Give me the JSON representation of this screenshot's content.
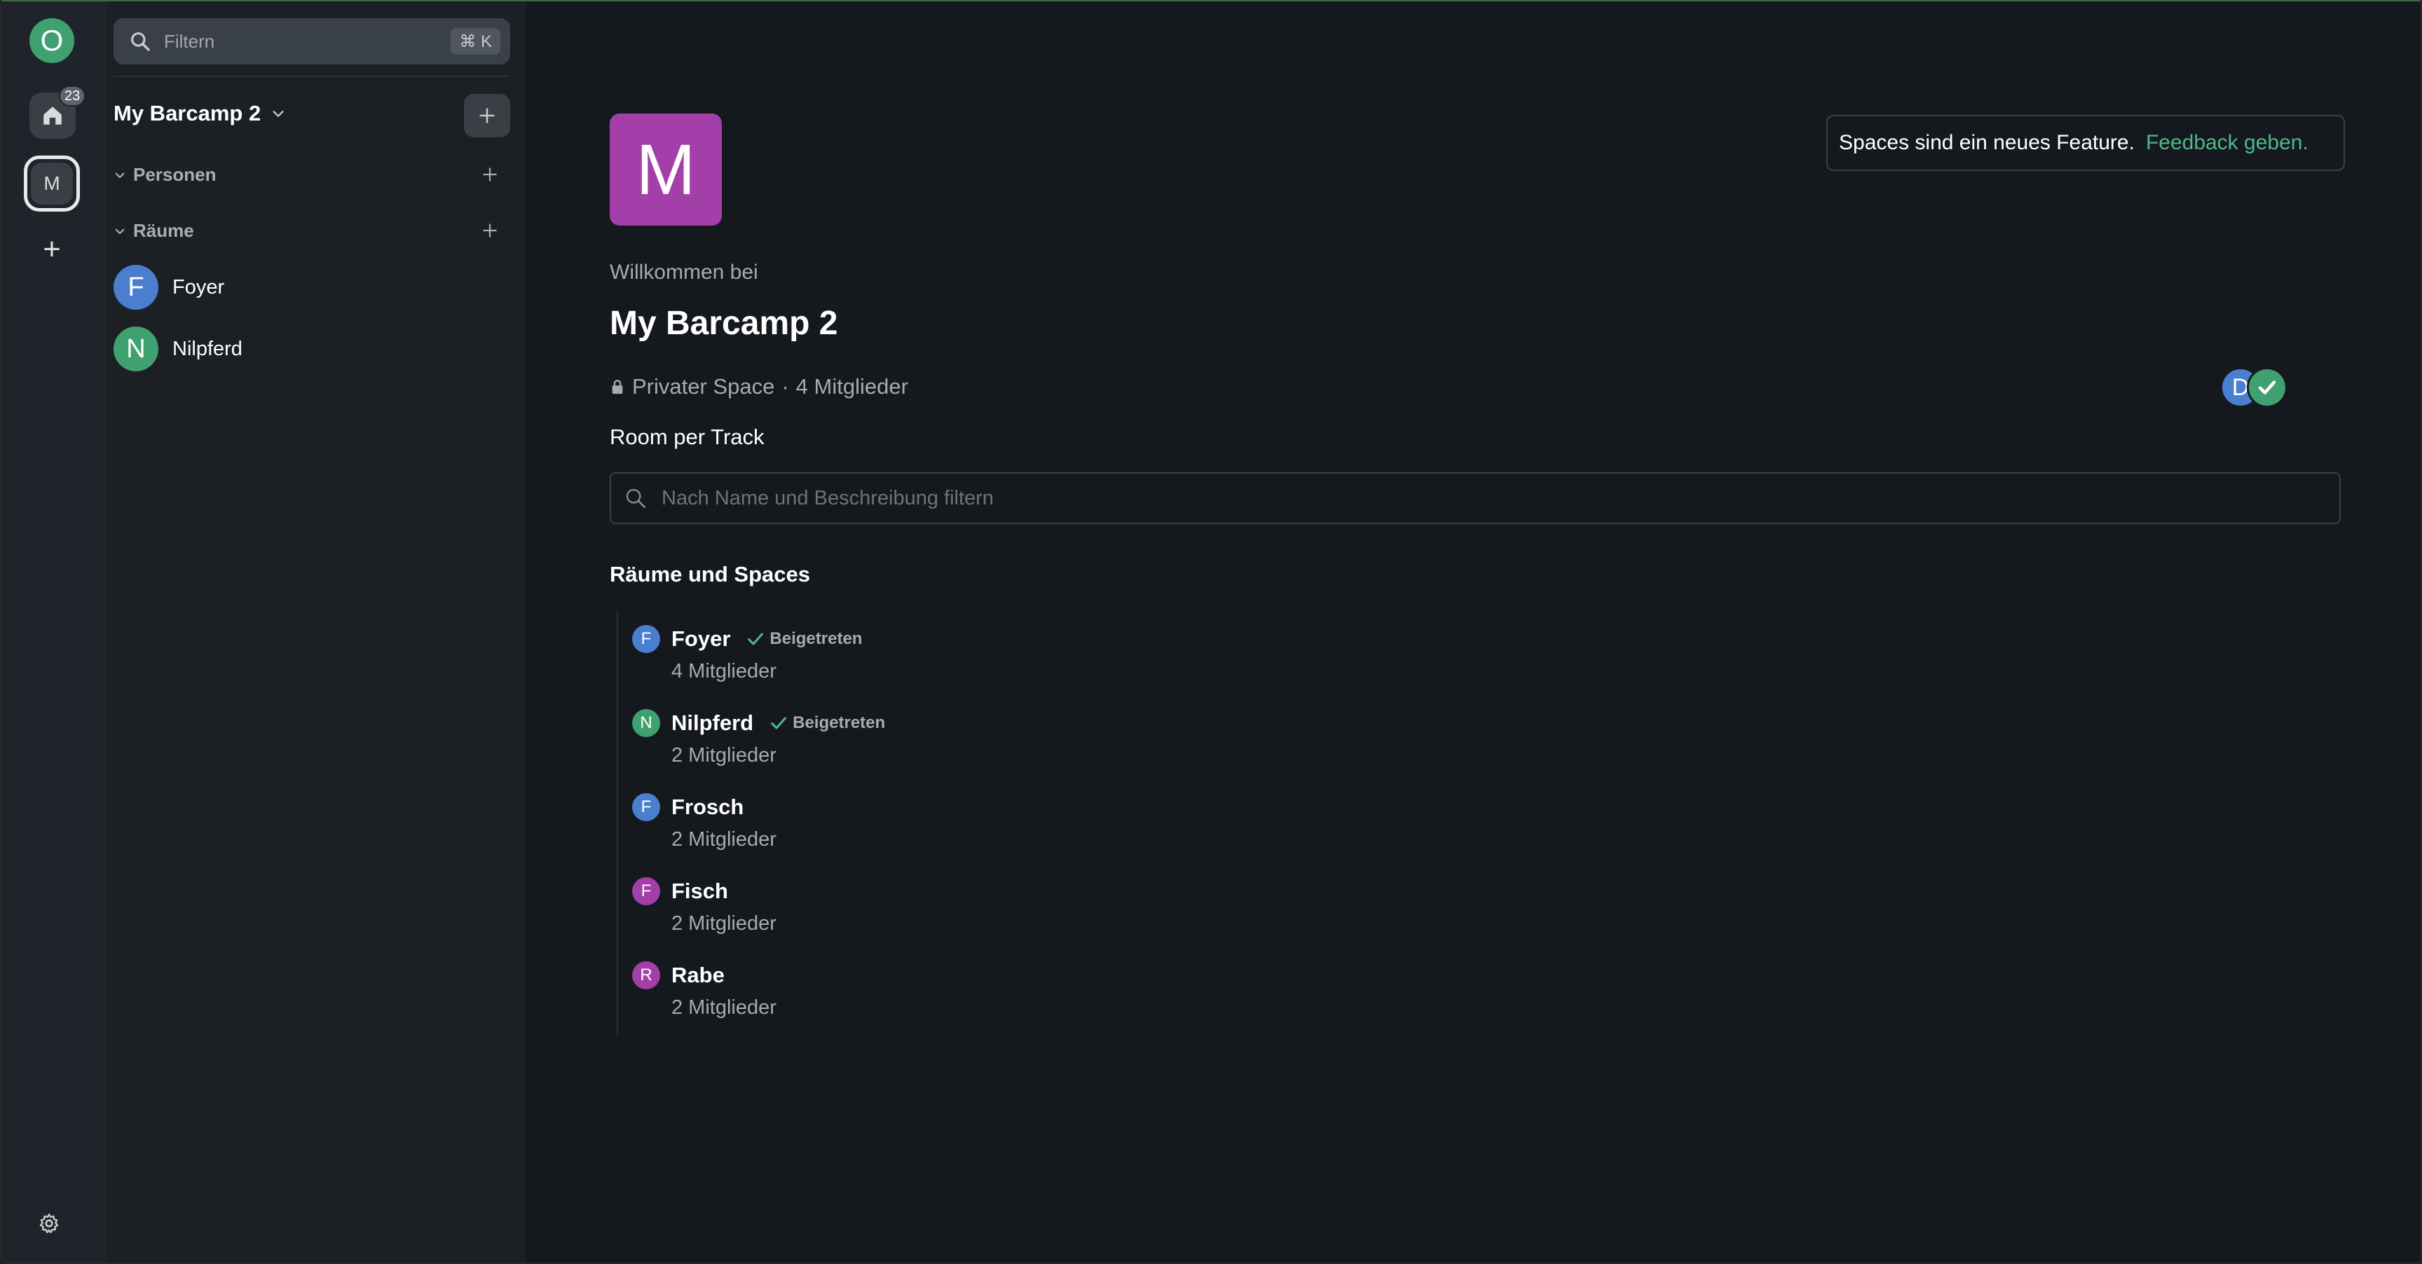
{
  "colors": {
    "accent_green": "#3fa170",
    "link_green": "#4fb888",
    "avatar_blue": "#4a7fcf",
    "avatar_purple": "#a33fa8",
    "background": "#15191e"
  },
  "rail": {
    "user_initial": "O",
    "home_icon": "home-icon",
    "home_badge": "23",
    "space_initial": "M",
    "add_icon": "+",
    "settings_icon": "gear-icon"
  },
  "roomlist": {
    "filter_placeholder": "Filtern",
    "filter_shortcut": "⌘ K",
    "space_name": "My Barcamp 2",
    "sections": {
      "people": "Personen",
      "rooms": "Räume"
    },
    "rooms": [
      {
        "initial": "F",
        "name": "Foyer",
        "color": "#4a7fcf"
      },
      {
        "initial": "N",
        "name": "Nilpferd",
        "color": "#3fa170"
      }
    ]
  },
  "main": {
    "avatar_initial": "M",
    "welcome": "Willkommen bei",
    "title": "My Barcamp 2",
    "visibility": "Privater Space",
    "separator": "·",
    "member_count": "4 Mitglieder",
    "topic": "Room per Track",
    "member_avatar_initial": "D",
    "notice_text": "Spaces sind ein neues Feature.",
    "notice_link": "Feedback geben.",
    "search_placeholder": "Nach Name und Beschreibung filtern",
    "section_title": "Räume und Spaces",
    "joined_label": "Beigetreten",
    "hierarchy": [
      {
        "initial": "F",
        "name": "Foyer",
        "members": "4 Mitglieder",
        "joined": true,
        "color": "#4a7fcf"
      },
      {
        "initial": "N",
        "name": "Nilpferd",
        "members": "2 Mitglieder",
        "joined": true,
        "color": "#3fa170"
      },
      {
        "initial": "F",
        "name": "Frosch",
        "members": "2 Mitglieder",
        "joined": false,
        "color": "#4a7fcf"
      },
      {
        "initial": "F",
        "name": "Fisch",
        "members": "2 Mitglieder",
        "joined": false,
        "color": "#a33fa8"
      },
      {
        "initial": "R",
        "name": "Rabe",
        "members": "2 Mitglieder",
        "joined": false,
        "color": "#a33fa8"
      }
    ]
  }
}
